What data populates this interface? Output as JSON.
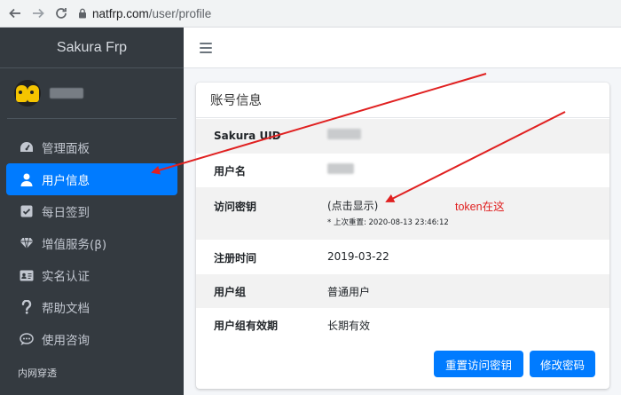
{
  "browser": {
    "url_host": "natfrp.com",
    "url_path": "/user/profile"
  },
  "sidebar": {
    "brand": "Sakura Frp",
    "items": [
      {
        "label": "管理面板",
        "icon": "dashboard-icon"
      },
      {
        "label": "用户信息",
        "icon": "user-icon",
        "active": true
      },
      {
        "label": "每日签到",
        "icon": "checkbox-icon"
      },
      {
        "label": "增值服务(β)",
        "icon": "diamond-icon"
      },
      {
        "label": "实名认证",
        "icon": "id-card-icon"
      },
      {
        "label": "帮助文档",
        "icon": "question-icon"
      },
      {
        "label": "使用咨询",
        "icon": "comment-icon"
      }
    ],
    "section_header": "内网穿透"
  },
  "card": {
    "title": "账号信息",
    "rows": [
      {
        "label": "Sakura UID",
        "value": ""
      },
      {
        "label": "用户名",
        "value": ""
      },
      {
        "label": "访问密钥",
        "value": "(点击显示)",
        "note": "* 上次重置: 2020-08-13 23:46:12"
      },
      {
        "label": "注册时间",
        "value": "2019-03-22"
      },
      {
        "label": "用户组",
        "value": "普通用户"
      },
      {
        "label": "用户组有效期",
        "value": "长期有效"
      }
    ],
    "buttons": {
      "reset_key": "重置访问密钥",
      "change_password": "修改密码"
    }
  },
  "annotation": {
    "text": "token在这",
    "color": "#e02020"
  },
  "colors": {
    "sidebar_bg": "#343a40",
    "accent": "#007bff",
    "main_bg": "#f4f6f9"
  }
}
